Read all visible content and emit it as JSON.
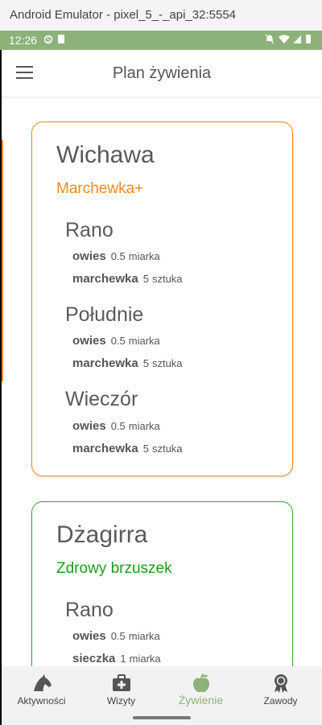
{
  "window": {
    "title": "Android Emulator - pixel_5_-_api_32:5554"
  },
  "status_bar": {
    "time": "12:26"
  },
  "app_bar": {
    "title": "Plan żywienia"
  },
  "cards": [
    {
      "horse": "Wichawa",
      "plan": "Marchewka+",
      "accent_color": "#f08a1e",
      "meals": [
        {
          "name": "Rano",
          "items": [
            {
              "food": "owies",
              "quantity": "0.5",
              "unit": "miarka"
            },
            {
              "food": "marchewka",
              "quantity": "5",
              "unit": "sztuka"
            }
          ]
        },
        {
          "name": "Południe",
          "items": [
            {
              "food": "owies",
              "quantity": "0.5",
              "unit": "miarka"
            },
            {
              "food": "marchewka",
              "quantity": "5",
              "unit": "sztuka"
            }
          ]
        },
        {
          "name": "Wieczór",
          "items": [
            {
              "food": "owies",
              "quantity": "0.5",
              "unit": "miarka"
            },
            {
              "food": "marchewka",
              "quantity": "5",
              "unit": "sztuka"
            }
          ]
        }
      ]
    },
    {
      "horse": "Dżagirra",
      "plan": "Zdrowy brzuszek",
      "accent_color": "#1e9b1e",
      "meals": [
        {
          "name": "Rano",
          "items": [
            {
              "food": "owies",
              "quantity": "0.5",
              "unit": "miarka"
            },
            {
              "food": "sieczka",
              "quantity": "1",
              "unit": "miarka"
            }
          ]
        }
      ]
    }
  ],
  "bottom_nav": {
    "active_color": "#8cb27a",
    "items": [
      {
        "label": "Aktywności",
        "icon": "horse-head-icon"
      },
      {
        "label": "Wizyty",
        "icon": "medical-bag-icon"
      },
      {
        "label": "Żywienie",
        "icon": "apple-icon"
      },
      {
        "label": "Zawody",
        "icon": "rosette-award-icon"
      }
    ]
  }
}
